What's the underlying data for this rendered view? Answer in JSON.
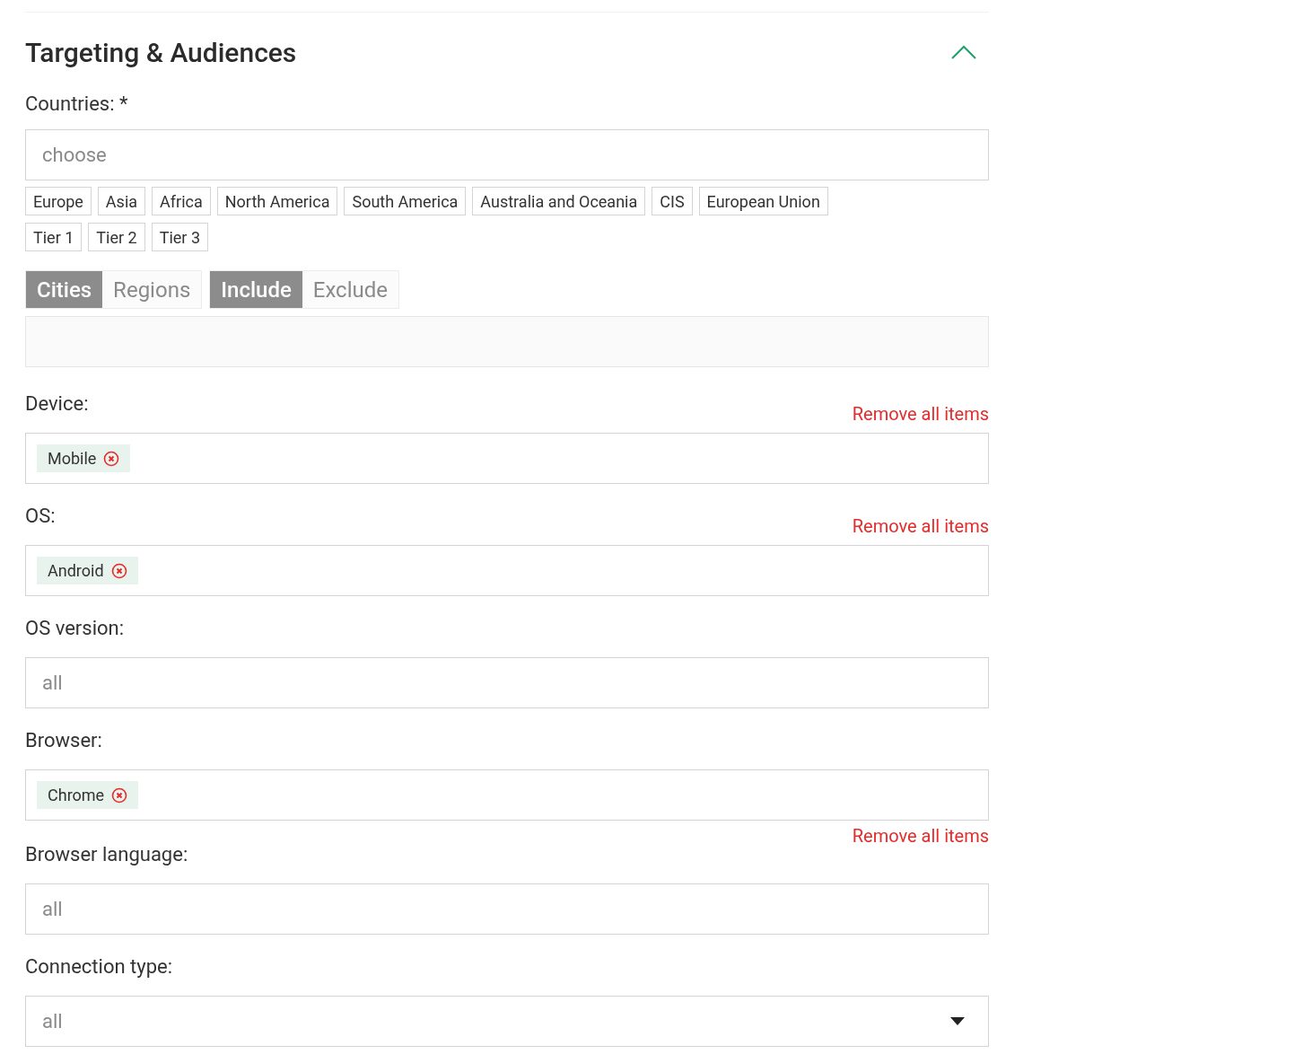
{
  "section": {
    "title": "Targeting & Audiences",
    "expanded": true
  },
  "countries": {
    "label": "Countries: *",
    "placeholder": "choose",
    "chip_rows": [
      [
        "Europe",
        "Asia",
        "Africa",
        "North America",
        "South America",
        "Australia and Oceania",
        "CIS",
        "European Union"
      ],
      [
        "Tier 1",
        "Tier 2",
        "Tier 3"
      ]
    ]
  },
  "segments": [
    [
      {
        "label": "Cities",
        "selected": true
      },
      {
        "label": "Regions",
        "selected": false
      }
    ],
    [
      {
        "label": "Include",
        "selected": true
      },
      {
        "label": "Exclude",
        "selected": false
      }
    ]
  ],
  "fields": [
    {
      "kind": "tags",
      "label": "Device:",
      "tags": [
        "Mobile"
      ],
      "remove_all": {
        "text": "Remove all items",
        "kind": "beside_label"
      }
    },
    {
      "kind": "tags",
      "label": "OS:",
      "tags": [
        "Android"
      ],
      "remove_all": {
        "text": "Remove all items",
        "kind": "beside_label"
      }
    },
    {
      "kind": "input",
      "label": "OS version:",
      "placeholder": "all"
    },
    {
      "kind": "tags",
      "label": "Browser:",
      "tags": [
        "Chrome"
      ],
      "remove_all": {
        "text": "Remove all items",
        "kind": "below_field"
      }
    },
    {
      "kind": "input",
      "label": "Browser language:",
      "placeholder": "all"
    },
    {
      "kind": "select",
      "label": "Connection type:",
      "value": "all"
    }
  ]
}
